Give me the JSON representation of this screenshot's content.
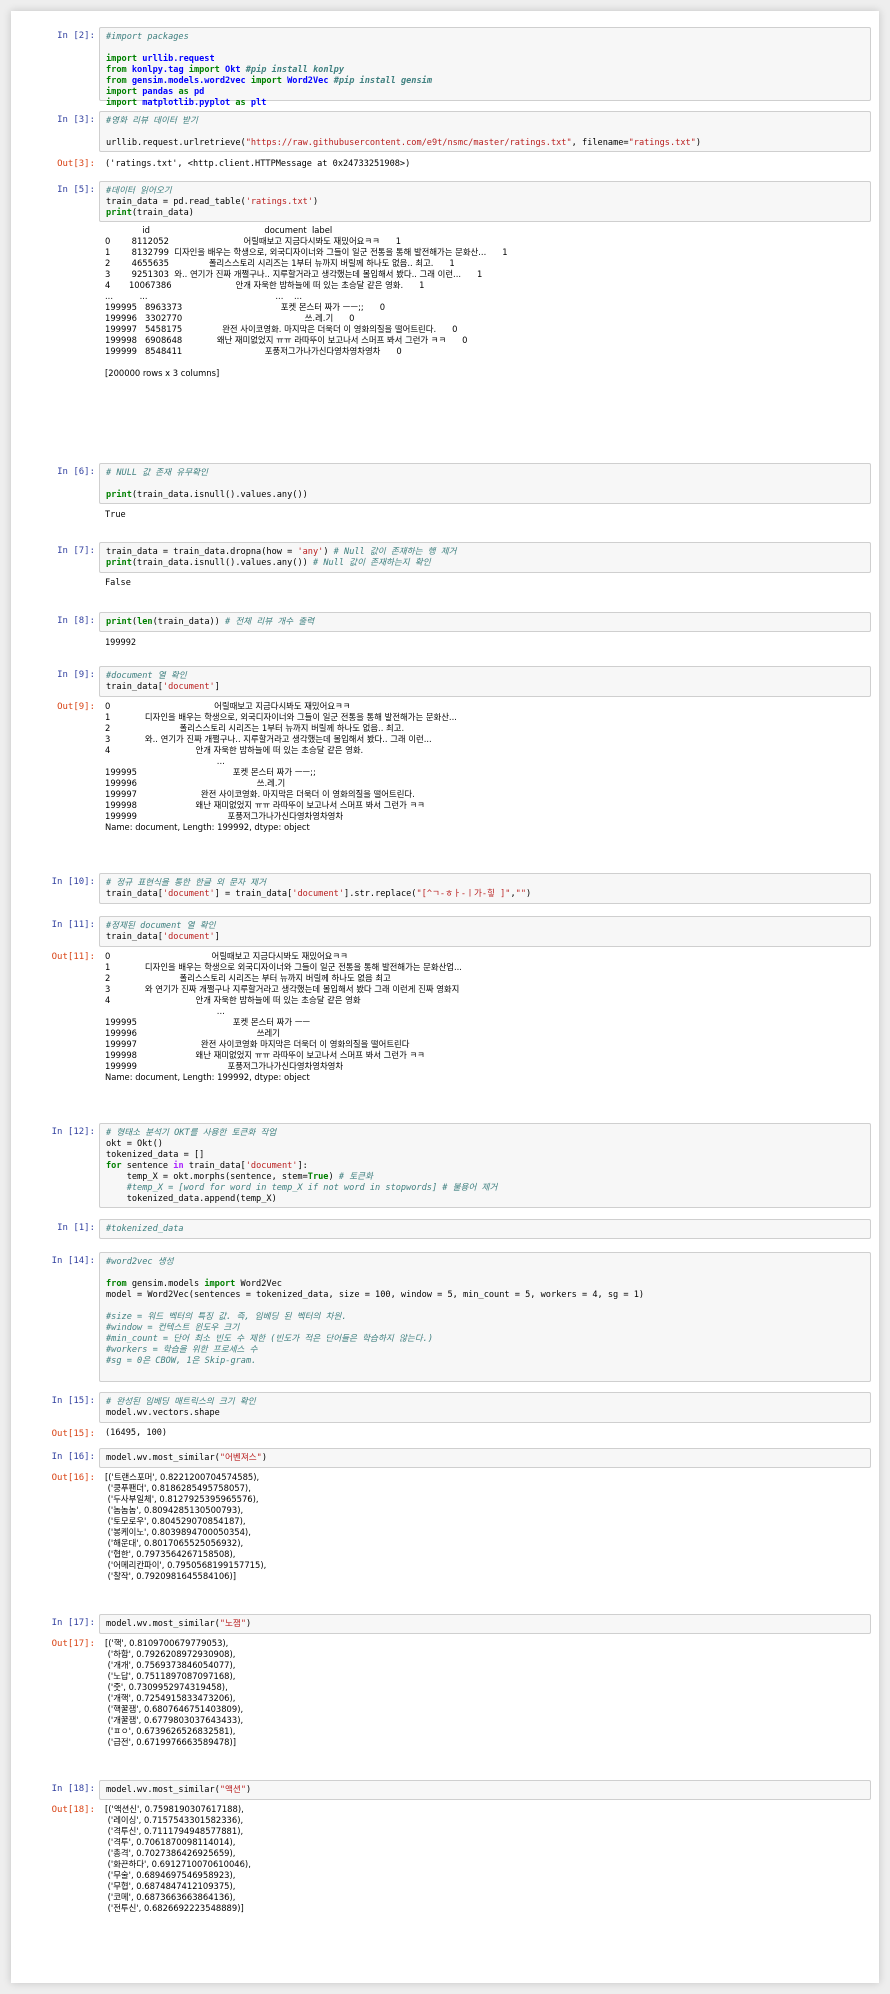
{
  "cells": [
    {
      "in_prompt": "In [2]:",
      "out_prompt": "",
      "code": [
        "#import packages",
        "",
        "import urllib.request",
        "from konlpy.tag import Okt #pip install konlpy",
        "from gensim.models.word2vec import Word2Vec #pip install gensim",
        "import pandas as pd",
        "import matplotlib.pyplot as plt"
      ],
      "output": []
    },
    {
      "in_prompt": "In [3]:",
      "out_prompt": "Out[3]:",
      "code": [
        "#영화 리뷰 데이터 받기",
        "",
        "urllib.request.urlretrieve(\"https://raw.githubusercontent.com/e9t/nsmc/master/ratings.txt\", filename=\"ratings.txt\")"
      ],
      "output": [
        "('ratings.txt', <http.client.HTTPMessage at 0x24733251908>)"
      ]
    },
    {
      "in_prompt": "In [5]:",
      "out_prompt": "",
      "code": [
        "#데이터 읽어오기",
        "train_data = pd.read_table('ratings.txt')",
        "print(train_data)"
      ],
      "output": [
        "              id                                           document  label",
        "0        8112052                            어릴때보고 지금다시봐도 재밌어요ㅋㅋ      1",
        "1        8132799  디자인을 배우는 학생으로, 외국디자이너와 그들이 일군 전통을 통해 발전해가는 문화산...      1",
        "2        4655635               폴리스스토리 시리즈는 1부터 뉴까지 버릴께 하나도 없음.. 최고.      1",
        "3        9251303  와.. 연기가 진짜 개쩔구나.. 지루할거라고 생각했는데 몰입해서 봤다.. 그래 이런...      1",
        "4       10067386                        안개 자욱한 밤하늘에 떠 있는 초승달 같은 영화.      1",
        "...          ...                                                ...    ...",
        "199995   8963373                                     포켓 몬스터 짜가 ㅡㅡ;;      0",
        "199996   3302770                                              쓰.레.기      0",
        "199997   5458175               완전 사이코영화. 마지막은 더욱더 이 영화의질을 떨어트린다.      0",
        "199998   6908648             왜난 재미없었지 ㅠㅠ 라따뚜이 보고나서 스머프 봐서 그런가 ㅋㅋ      0",
        "199999   8548411                               포풍저그가나가신다영차영차영차      0",
        "",
        "[200000 rows x 3 columns]"
      ]
    },
    {
      "in_prompt": "In [6]:",
      "out_prompt": "",
      "code": [
        "# NULL 값 존재 유무확인",
        "",
        "print(train_data.isnull().values.any())"
      ],
      "output": [
        "True"
      ]
    },
    {
      "in_prompt": "In [7]:",
      "out_prompt": "",
      "code": [
        "train_data = train_data.dropna(how = 'any') # Null 값이 존재하는 행 제거",
        "print(train_data.isnull().values.any()) # Null 값이 존재하는지 확인"
      ],
      "output": [
        "False"
      ]
    },
    {
      "in_prompt": "In [8]:",
      "out_prompt": "",
      "code": [
        "print(len(train_data)) # 전체 리뷰 개수 출력"
      ],
      "output": [
        "199992"
      ]
    },
    {
      "in_prompt": "In [9]:",
      "out_prompt": "Out[9]:",
      "code": [
        "#document 열 확인",
        "train_data['document']"
      ],
      "output": [
        "0                                       어릴때보고 지금다시봐도 재밌어요ㅋㅋ",
        "1             디자인을 배우는 학생으로, 외국디자이너와 그들이 일군 전통을 통해 발전해가는 문화산...",
        "2                          폴리스스토리 시리즈는 1부터 뉴까지 버릴께 하나도 없음.. 최고.",
        "3             와.. 연기가 진짜 개쩔구나.. 지루할거라고 생각했는데 몰입해서 봤다.. 그래 이런...",
        "4                                안개 자욱한 밤하늘에 떠 있는 초승달 같은 영화.",
        "                                          ...",
        "199995                                    포켓 몬스터 짜가 ㅡㅡ;;",
        "199996                                             쓰.레.기",
        "199997                        완전 사이코영화. 마지막은 더욱더 이 영화의질을 떨어트린다.",
        "199998                      왜난 재미없었지 ㅠㅠ 라따뚜이 보고나서 스머프 봐서 그런가 ㅋㅋ",
        "199999                                  포풍저그가나가신다영차영차영차",
        "Name: document, Length: 199992, dtype: object"
      ]
    },
    {
      "in_prompt": "In [10]:",
      "out_prompt": "",
      "code": [
        "# 정규 표현식을 통한 한글 외 문자 제거",
        "train_data['document'] = train_data['document'].str.replace(\"[^ㄱ-ㅎㅏ-ㅣ가-힣 ]\",\"\")"
      ],
      "output": []
    },
    {
      "in_prompt": "In [11]:",
      "out_prompt": "Out[11]:",
      "code": [
        "#정제된 document 열 확인",
        "train_data['document']"
      ],
      "output": [
        "0                                      어릴때보고 지금다시봐도 재밌어요ㅋㅋ",
        "1             디자인을 배우는 학생으로 외국디자이너와 그들이 일군 전통을 통해 발전해가는 문화산업...",
        "2                          폴리스스토리 시리즈는 부터 뉴까지 버릴께 하나도 없음 최고",
        "3             와 연기가 진짜 개쩔구나 지루할거라고 생각했는데 몰입해서 봤다 그래 이런게 진짜 영화지",
        "4                                안개 자욱한 밤하늘에 떠 있는 초승달 같은 영화",
        "                                          ...",
        "199995                                    포켓 몬스터 짜가 ㅡㅡ",
        "199996                                             쓰레기",
        "199997                        완전 사이코영화 마지막은 더욱더 이 영화의질을 떨어트린다",
        "199998                      왜난 재미없었지 ㅠㅠ 라따뚜이 보고나서 스머프 봐서 그런가 ㅋㅋ",
        "199999                                  포풍저그가나가신다영차영차영차",
        "Name: document, Length: 199992, dtype: object"
      ]
    },
    {
      "in_prompt": "In [12]:",
      "out_prompt": "",
      "code": [
        "# 형태소 분석기 OKT를 사용한 토큰화 작업",
        "okt = Okt()",
        "tokenized_data = []",
        "for sentence in train_data['document']:",
        "    temp_X = okt.morphs(sentence, stem=True) # 토큰화",
        "    #temp_X = [word for word in temp_X if not word in stopwords] # 불용어 제거",
        "    tokenized_data.append(temp_X)"
      ],
      "output": []
    },
    {
      "in_prompt": "In [1]:",
      "out_prompt": "",
      "code": [
        "#tokenized_data"
      ],
      "output": []
    },
    {
      "in_prompt": "In [14]:",
      "out_prompt": "",
      "code": [
        "#word2vec 생성",
        "",
        "from gensim.models import Word2Vec",
        "model = Word2Vec(sentences = tokenized_data, size = 100, window = 5, min_count = 5, workers = 4, sg = 1)",
        "",
        "#size = 워드 벡터의 특징 값. 즉, 임베딩 된 벡터의 차원.",
        "#window = 컨텍스트 윈도우 크기",
        "#min_count = 단어 최소 빈도 수 제한 (빈도가 적은 단어들은 학습하지 않는다.)",
        "#workers = 학습을 위한 프로세스 수",
        "#sg = 0은 CBOW, 1은 Skip-gram."
      ],
      "output": []
    },
    {
      "in_prompt": "In [15]:",
      "out_prompt": "Out[15]:",
      "code": [
        "# 완성된 임베딩 매트릭스의 크기 확인",
        "model.wv.vectors.shape"
      ],
      "output": [
        "(16495, 100)"
      ]
    },
    {
      "in_prompt": "In [16]:",
      "out_prompt": "Out[16]:",
      "code": [
        "model.wv.most_similar(\"어벤져스\")"
      ],
      "output": [
        "[('트랜스포머', 0.8221200704574585),",
        " ('쿵푸팬더', 0.8186285495758057),",
        " ('두사부일체', 0.8127925395965576),",
        " ('놈놈놈', 0.8094285130500793),",
        " ('토모로우', 0.804529070854187),",
        " ('봉케이노', 0.8039894700050354),",
        " ('해운대', 0.8017065525056932),",
        " ('협한', 0.7973564267158508),",
        " ('어메리칸파이', 0.7950568199157715),",
        " ('찰작', 0.7920981645584106)]"
      ]
    },
    {
      "in_prompt": "In [17]:",
      "out_prompt": "Out[17]:",
      "code": [
        "model.wv.most_similar(\"노잼\")"
      ],
      "output": [
        "[('핵', 0.8109700679779053),",
        " ('하함', 0.7926208972930908),",
        " ('개개', 0.7569373846054077),",
        " ('노답', 0.7511897087097168),",
        " ('줏', 0.7309952974319458),",
        " ('개핵', 0.7254915833473206),",
        " ('핵꿀잼', 0.6807646751403809),",
        " ('개꿀잼', 0.6779803037643433),",
        " ('ㅍㅇ', 0.6739626526832581),",
        " ('급전', 0.6719976663589478)]"
      ]
    },
    {
      "in_prompt": "In [18]:",
      "out_prompt": "Out[18]:",
      "code": [
        "model.wv.most_similar(\"액션\")"
      ],
      "output": [
        "[('액션신', 0.7598190307617188),",
        " ('레이싱', 0.7157543301582336),",
        " ('격투신', 0.7111794948577881),",
        " ('격투', 0.7061870098114014),",
        " ('총격', 0.7027386426925659),",
        " ('화끈하다', 0.6912710070610046),",
        " ('무술', 0.6894697546958923),",
        " ('무협', 0.6874847412109375),",
        " ('코메', 0.6873663663864136),",
        " ('전투신', 0.6826692223548889)]"
      ]
    }
  ]
}
